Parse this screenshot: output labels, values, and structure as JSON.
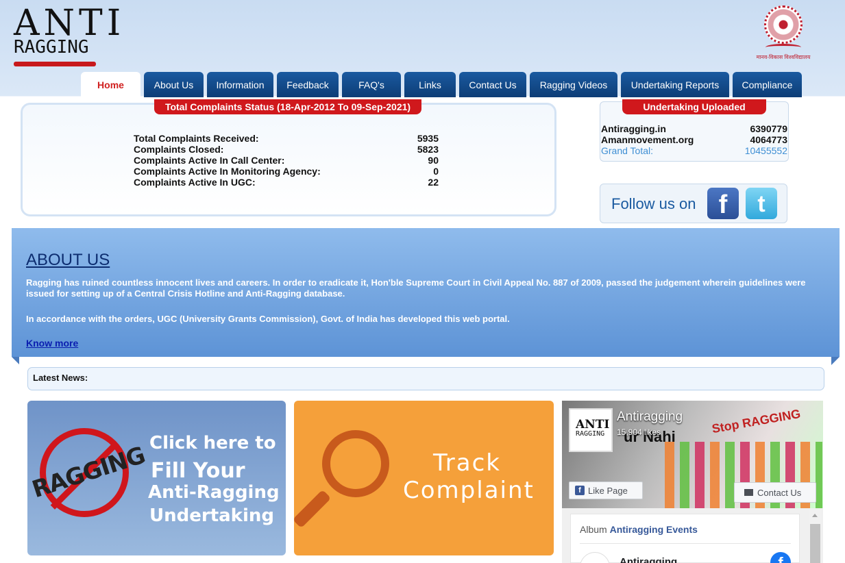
{
  "header": {
    "logo_top": "ANTI",
    "logo_bottom": "RAGGING",
    "seal_caption": "मानव-विकास विश्वविद्यालय"
  },
  "nav": {
    "tabs": [
      {
        "label": "Home",
        "active": true
      },
      {
        "label": "About Us"
      },
      {
        "label": "Information"
      },
      {
        "label": "Feedback"
      },
      {
        "label": "FAQ's"
      },
      {
        "label": "Links"
      },
      {
        "label": "Contact Us"
      },
      {
        "label": "Ragging Videos"
      },
      {
        "label": "Undertaking Reports"
      },
      {
        "label": "Compliance"
      }
    ]
  },
  "complaints": {
    "title": "Total Complaints Status (18-Apr-2012 To 09-Sep-2021)",
    "rows": [
      {
        "label": "Total Complaints Received:",
        "value": "5935"
      },
      {
        "label": "Complaints Closed:",
        "value": "5823"
      },
      {
        "label": "Complaints Active In Call Center:",
        "value": "90"
      },
      {
        "label": "Complaints Active In Monitoring Agency:",
        "value": "0"
      },
      {
        "label": "Complaints Active In UGC:",
        "value": "22"
      }
    ]
  },
  "undertaking": {
    "title": "Undertaking Uploaded",
    "rows": [
      {
        "label": "Antiragging.in",
        "value": "6390779"
      },
      {
        "label": "Amanmovement.org",
        "value": "4064773"
      },
      {
        "label": "Grand Total:",
        "value": "10455552"
      }
    ]
  },
  "follow": {
    "label": "Follow us on",
    "facebook_glyph": "f",
    "twitter_glyph": "t"
  },
  "about": {
    "title": "ABOUT US",
    "paragraph1": "Ragging has ruined countless innocent lives and careers. In order to eradicate it, Hon'ble Supreme Court in Civil Appeal No. 887 of 2009, passed the judgement wherein guidelines were issued for setting up of a Central Crisis Hotline and Anti-Ragging database.",
    "paragraph2": "In accordance with the orders, UGC (University Grants Commission), Govt. of India has developed this web portal.",
    "link": "Know more"
  },
  "news": {
    "label": "Latest News:"
  },
  "tiles": {
    "undertaking": {
      "sign_text": "RAGGING",
      "line1": "Click here to",
      "line2": "Fill Your",
      "line3": "Anti-Ragging",
      "line4": "Undertaking"
    },
    "track": {
      "line1": "Track",
      "line2": "Complaint"
    }
  },
  "facebook": {
    "page_name": "Antiragging",
    "likes": "15,904 likes",
    "thumb_top": "ANTI",
    "thumb_bottom": "RAGGING",
    "cover_stop": "Stop RAGGING",
    "cover_nahi": "ur Nahi",
    "like_button": "Like Page",
    "contact_button": "Contact Us",
    "album_prefix": "Album",
    "album_name": "Antiragging Events",
    "row_name": "Antiragging"
  },
  "colors": {
    "nav_blue": "#0d3d76",
    "pill_red": "#d0181c",
    "about_blue": "#5d93d6",
    "tile_orange": "#f5a03a",
    "facebook_blue": "#3b5998"
  }
}
